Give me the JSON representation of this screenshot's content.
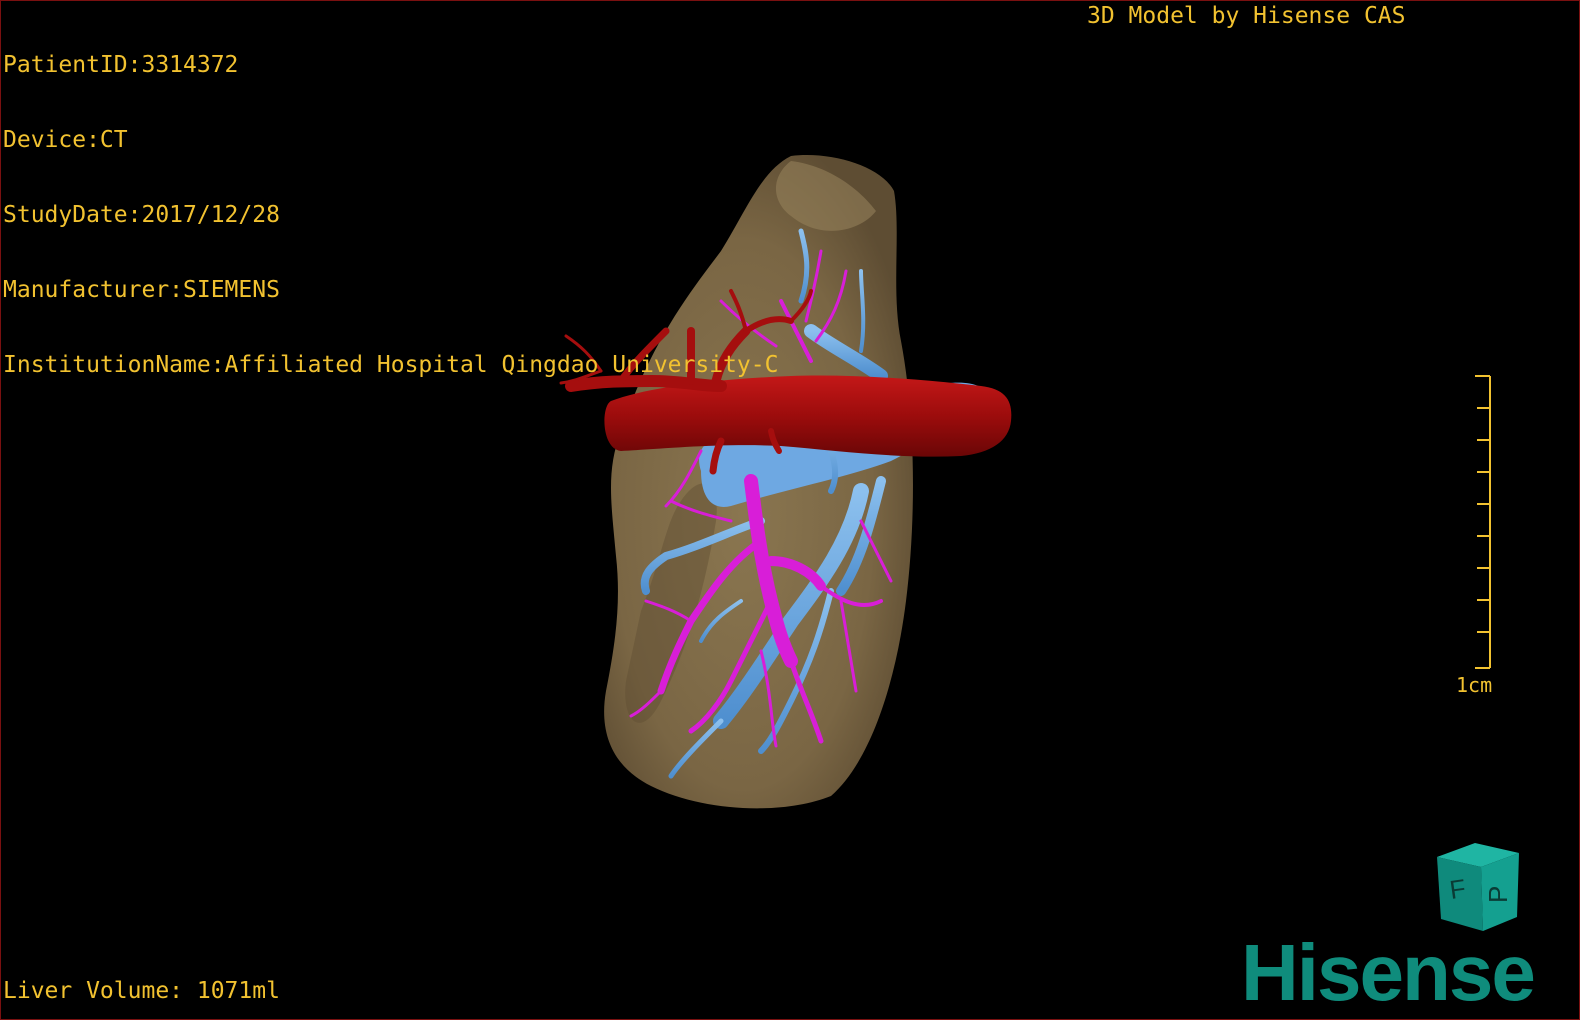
{
  "header": {
    "patient_id": "PatientID:3314372",
    "device": "Device:CT",
    "study_date": "StudyDate:2017/12/28",
    "manufacturer": "Manufacturer:SIEMENS",
    "institution": "InstitutionName:Affiliated Hospital Qingdao University-C",
    "model_label": "3D Model by Hisense CAS"
  },
  "footer": {
    "liver_volume": "Liver Volume: 1071ml",
    "logo_text": "Hisense"
  },
  "scale": {
    "label": "1cm"
  },
  "orientation_cube": {
    "faces": [
      "F",
      "P"
    ]
  },
  "colors": {
    "overlay_text": "#f2c230",
    "liver": "#7d6a48",
    "artery": "#a00f0f",
    "portal_vein": "#d81ed8",
    "hepatic_vein": "#64a5e0",
    "logo": "#0f8c7c",
    "cube": "#14a090",
    "viewport_border": "#7a1010"
  },
  "icons": [
    "orientation-cube-icon",
    "hisense-logo"
  ]
}
